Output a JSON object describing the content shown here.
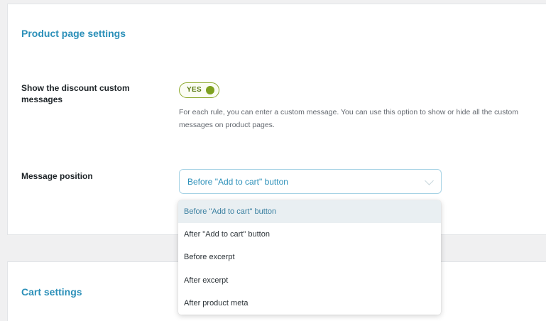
{
  "product_settings": {
    "title": "Product page settings",
    "discount_messages": {
      "label": "Show the discount custom messages",
      "toggle_text": "YES",
      "toggle_on": true,
      "description": "For each rule, you can enter a custom message. You can use this option to show or hide all the custom messages on product pages."
    },
    "message_position": {
      "label": "Message position",
      "selected": "Before \"Add to cart\" button",
      "options": [
        "Before \"Add to cart\" button",
        "After \"Add to cart\" button",
        "Before excerpt",
        "After excerpt",
        "After product meta"
      ]
    }
  },
  "cart_settings": {
    "title": "Cart settings"
  },
  "colors": {
    "accent": "#2c90b9",
    "toggle_green": "#7ea120"
  }
}
